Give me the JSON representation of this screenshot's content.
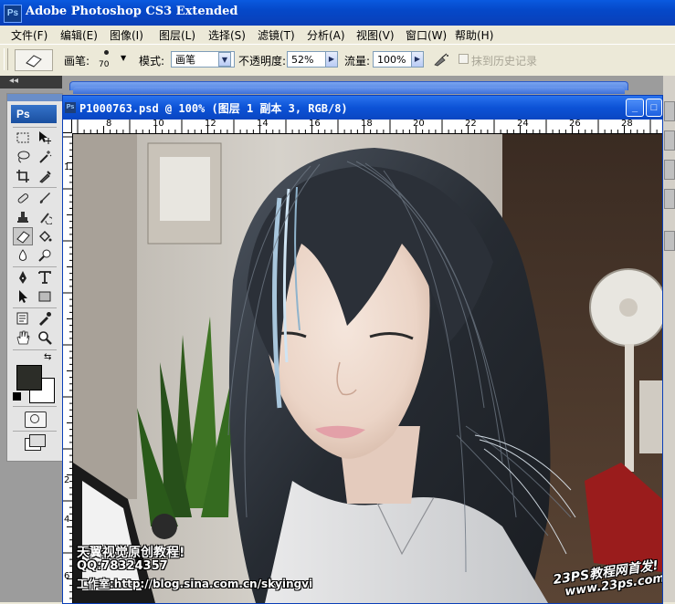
{
  "window": {
    "title": "Adobe Photoshop CS3 Extended",
    "app_icon_label": "Ps"
  },
  "menu": [
    {
      "label": "文件(F)"
    },
    {
      "label": "编辑(E)"
    },
    {
      "label": "图像(I)"
    },
    {
      "label": "图层(L)"
    },
    {
      "label": "选择(S)"
    },
    {
      "label": "滤镜(T)"
    },
    {
      "label": "分析(A)"
    },
    {
      "label": "视图(V)"
    },
    {
      "label": "窗口(W)"
    },
    {
      "label": "帮助(H)"
    }
  ],
  "options": {
    "brush_label": "画笔:",
    "brush_size": "70",
    "mode_label": "模式:",
    "mode_value": "画笔",
    "opacity_label": "不透明度:",
    "opacity_value": "52%",
    "flow_label": "流量:",
    "flow_value": "100%",
    "erase_history_label": "抹到历史记录",
    "erase_history_checked": false
  },
  "toolbox": {
    "logo": "Ps",
    "foreground_color": "#2c2d28",
    "background_color": "#ffffff"
  },
  "document": {
    "title": "P1000763.psd @ 100% (图层 1 副本 3, RGB/8)",
    "icon_label": "Ps",
    "ruler_top_ticks": [
      "8",
      "10",
      "12",
      "14",
      "16",
      "18",
      "20",
      "22",
      "24",
      "26",
      "28"
    ],
    "ruler_left_ticks": [
      "1",
      "2",
      "4",
      "6"
    ]
  },
  "watermarks": {
    "studio": "天翼视觉原创教程!",
    "qq": "QQ:78324357",
    "blog": "工作室:http://blog.sina.com.cn/skyingvi",
    "site_name": "23PS教程网首发!",
    "site_url": "www.23ps.com"
  }
}
